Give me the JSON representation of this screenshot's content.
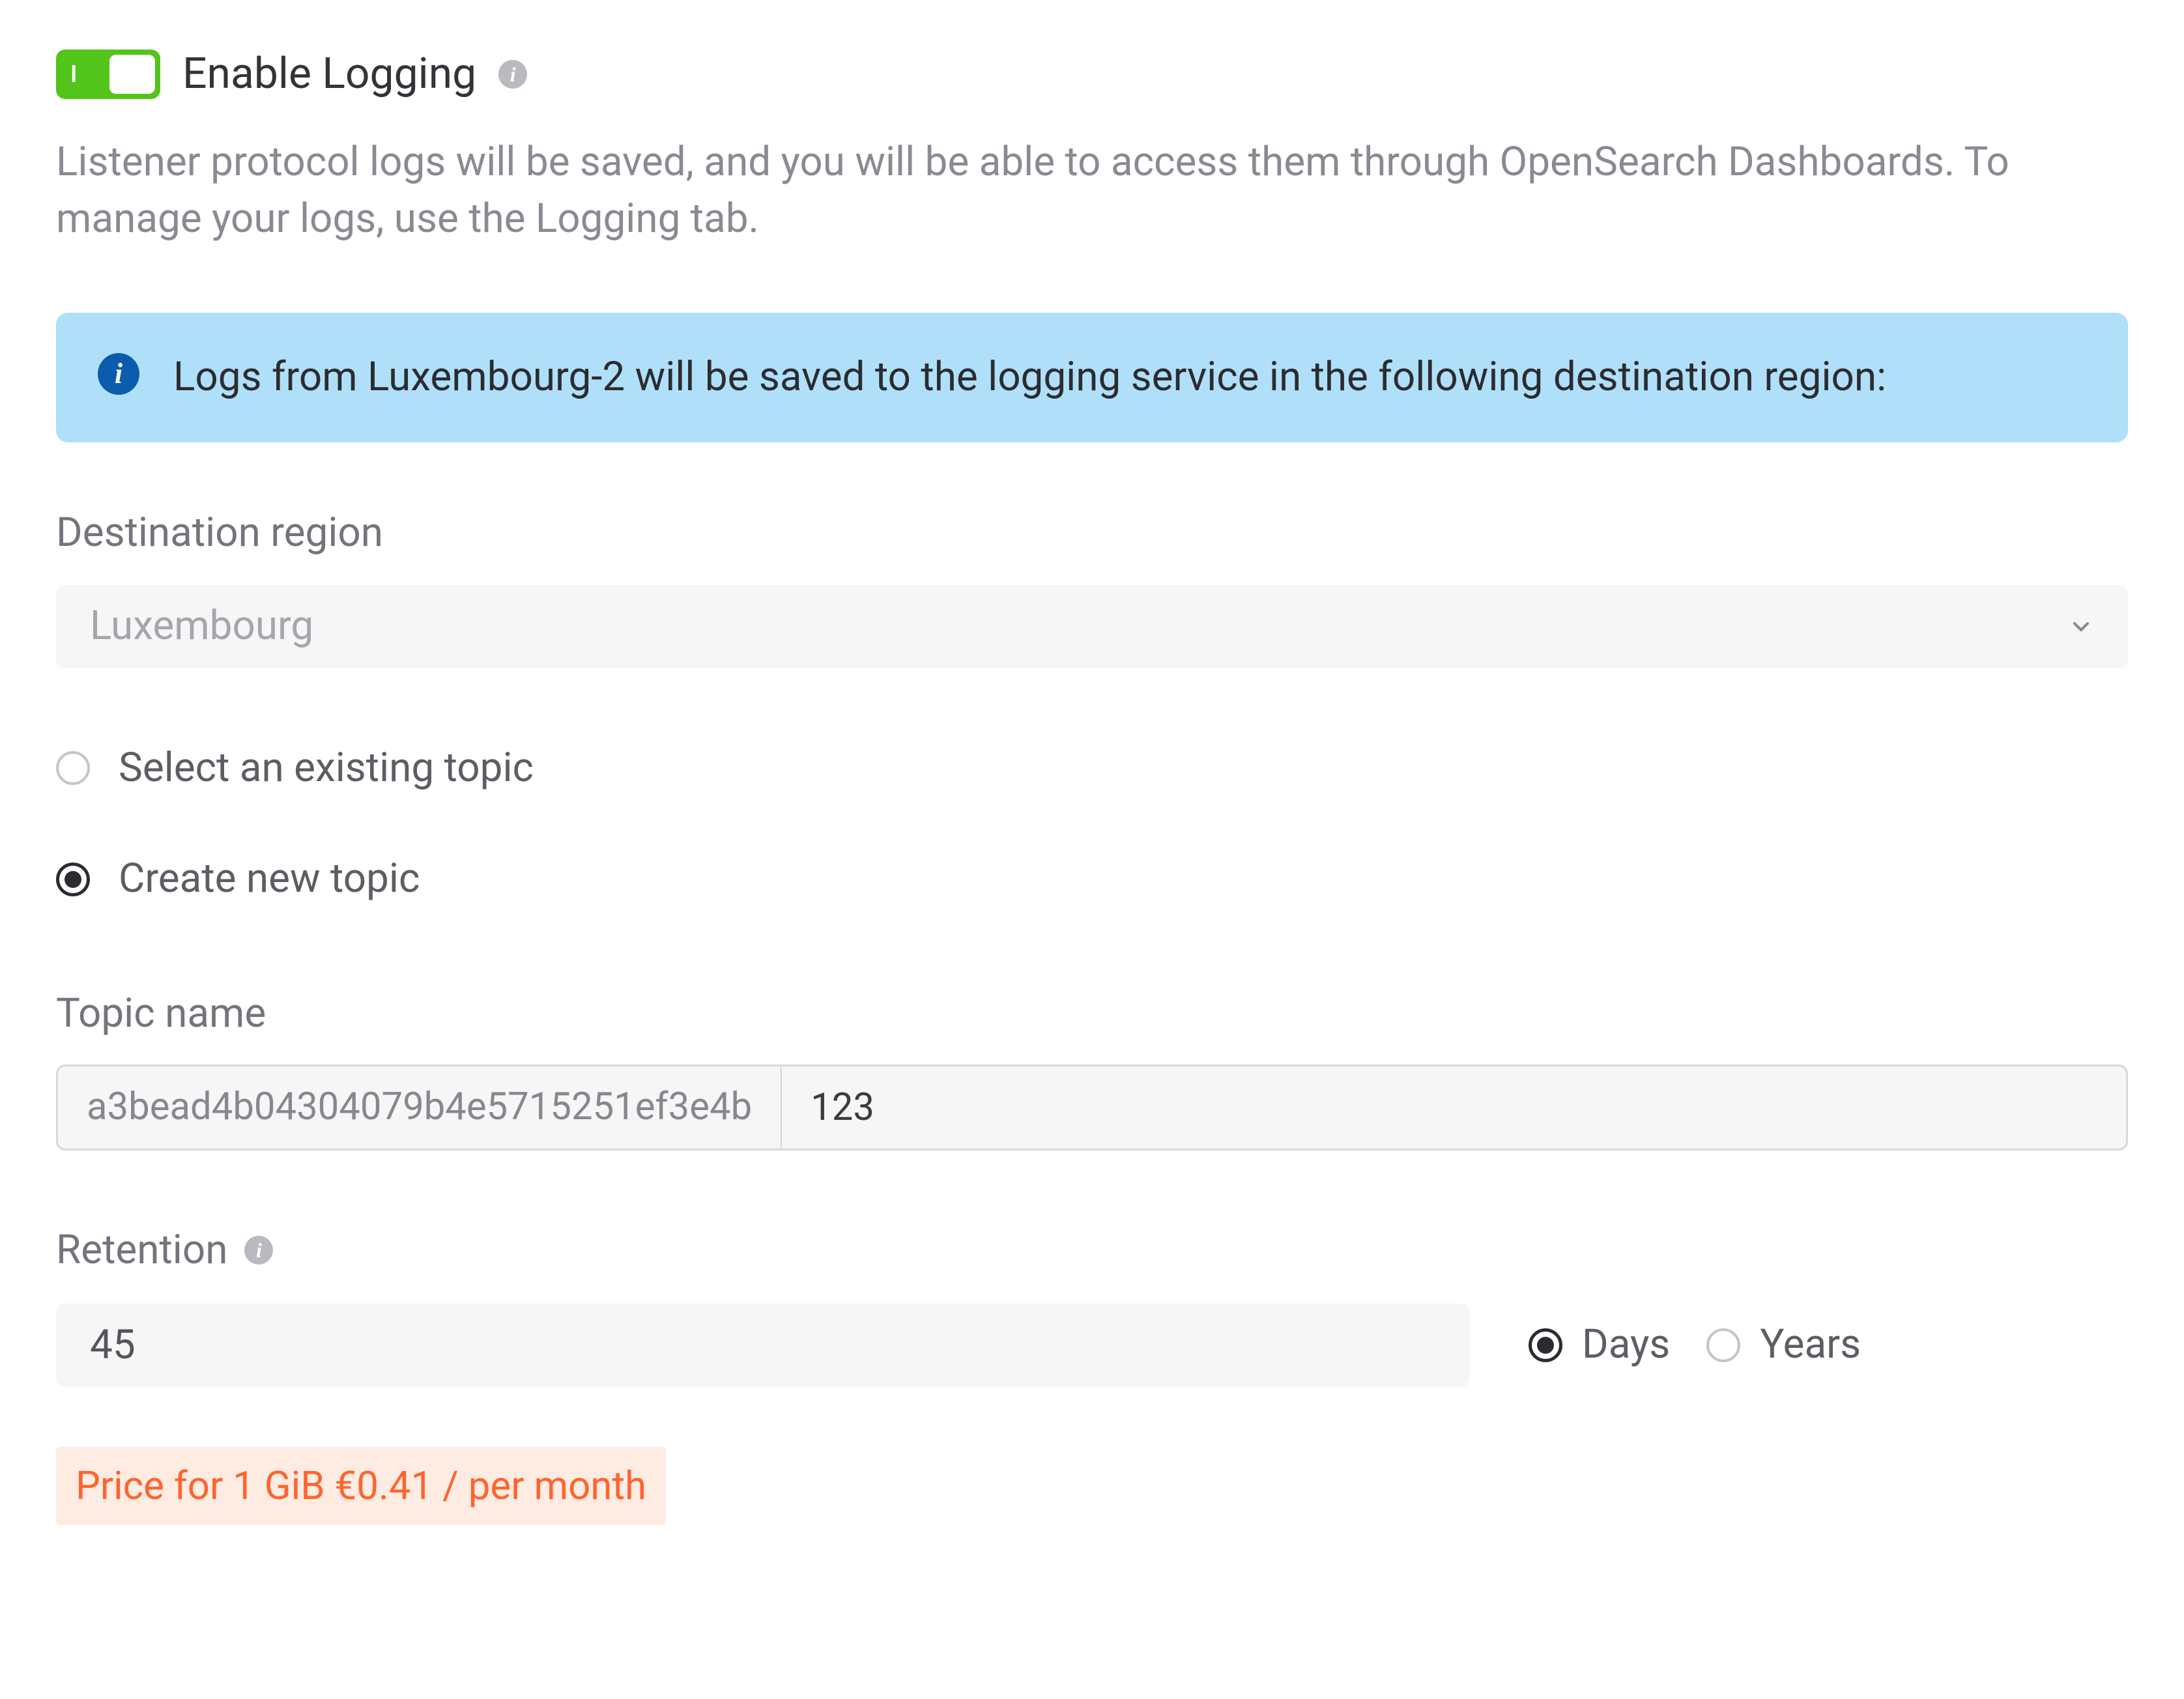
{
  "toggle": {
    "label": "Enable Logging",
    "on": true
  },
  "description": "Listener protocol logs will be saved, and you will be able to access them through OpenSearch Dashboards. To manage your logs, use the Logging tab.",
  "banner": {
    "text": "Logs from Luxembourg-2 will be saved to the logging service in the following destination region:"
  },
  "destination": {
    "label": "Destination region",
    "value": "Luxembourg"
  },
  "topic_mode": {
    "existing_label": "Select an existing topic",
    "create_label": "Create new topic",
    "selected": "create"
  },
  "topic_name": {
    "label": "Topic name",
    "prefix": "a3bead4b04304079b4e5715251ef3e4b",
    "value": "123"
  },
  "retention": {
    "label": "Retention",
    "value": "45",
    "units": {
      "days": "Days",
      "years": "Years",
      "selected": "days"
    }
  },
  "price": "Price for 1 GiB €0.41 / per month"
}
